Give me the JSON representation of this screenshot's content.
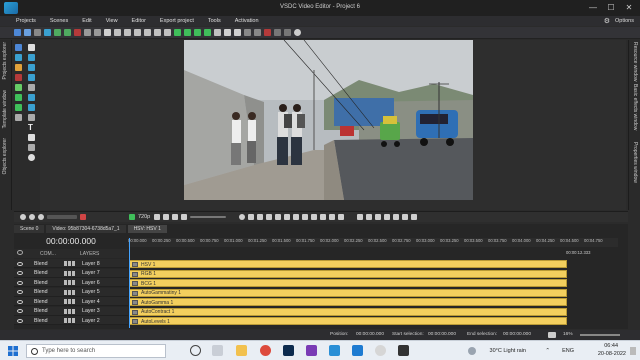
{
  "window": {
    "title": "VSDC Video Editor - Project 6",
    "min": "—",
    "max": "☐",
    "close": "✕"
  },
  "menu": {
    "items": [
      "Projects",
      "Scenes",
      "Edit",
      "View",
      "Editor",
      "Export project",
      "Tools",
      "Activation"
    ],
    "options_label": "Options"
  },
  "left_tabs": [
    "Projects explorer",
    "Template window",
    "Objects explorer"
  ],
  "right_tabs": [
    "Resource window",
    "Basic effects window",
    "Properties window"
  ],
  "player": {
    "quality": "720p",
    "icons": [
      "add-icon",
      "remove-icon",
      "record-icon",
      "zoom-icon",
      "play-icon",
      "stop-icon",
      "skip-icon"
    ]
  },
  "timeline_tabs": [
    "Scene 0",
    "Video: 95b87304-6738d5a7_1",
    "HSV: HSV 1"
  ],
  "timeline": {
    "timecode": "00:00:00.000",
    "column_com": "COM...",
    "column_layers": "LAYERS",
    "end_time": "00:00:12.333",
    "ruler_ticks": [
      "00:00.000",
      "00:00.250",
      "00:00.500",
      "00:00.750",
      "00:01.000",
      "00:01.250",
      "00:01.500",
      "00:01.750",
      "00:02.000",
      "00:02.250",
      "00:02.500",
      "00:02.750",
      "00:03.000",
      "00:03.250",
      "00:03.500",
      "00:03.750",
      "00:04.000",
      "00:04.250",
      "00:04.500",
      "00:04.750",
      "00:05.000"
    ],
    "tracks": [
      {
        "blend": "Blend",
        "layer": "Layer 8",
        "clip": "HSV 1"
      },
      {
        "blend": "Blend",
        "layer": "Layer 7",
        "clip": "RGB 1"
      },
      {
        "blend": "Blend",
        "layer": "Layer 6",
        "clip": "BCG 1"
      },
      {
        "blend": "Blend",
        "layer": "Layer 5",
        "clip": "AutoGammatiny 1"
      },
      {
        "blend": "Blend",
        "layer": "Layer 4",
        "clip": "AutoGamma 1"
      },
      {
        "blend": "Blend",
        "layer": "Layer 3",
        "clip": "AutoContract 1"
      },
      {
        "blend": "Blend",
        "layer": "Layer 2",
        "clip": "AutoLevels 1"
      }
    ]
  },
  "status": {
    "position_label": "Position:",
    "position_value": "00:00:00.000",
    "start_label": "Start selection:",
    "start_value": "00:00:00.000",
    "end_label": "End selection:",
    "end_value": "00:00:00.000",
    "zoom": "16%"
  },
  "taskbar": {
    "search_placeholder": "Type here to search",
    "weather": "30°C  Light rain",
    "lang": "ENG",
    "time": "06:44",
    "date": "20-08-2022"
  },
  "colors": {
    "clip_yellow": "#f3cf5e",
    "playhead_blue": "#45a4ff",
    "toolbar_green": "#3fbf5a"
  }
}
